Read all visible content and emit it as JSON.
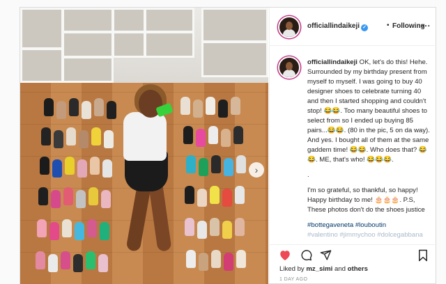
{
  "header": {
    "username": "officiallindaikeji",
    "verified_symbol": "✓",
    "dot": "•",
    "follow_status": "Following",
    "more_label": "..."
  },
  "caption": {
    "username": "officiallindaikeji",
    "paragraph1": "OK, let's do this! Hehe. Surrounded by my birthday present from myself to myself. I was going to buy 40 designer shoes to celebrate turning 40 and then I started shopping and couldn't stop! 😂😂. Too many beautiful shoes to select from so I ended up buying 85 pairs...😂😂. (80 in the pic, 5 on da way). And yes. I bought all of them at the same gaddem time! 😂😂. Who does that? 😂😂. ME, that's who! 😂😂😂.",
    "dot_line": ".",
    "paragraph2": "I'm so grateful, so thankful, so happy! Happy birthday to me! 🎂🎂🎂. P.S, These photos don't do the shoes justice",
    "hashtags": "#bottegaveneta #louboutin",
    "hashtags_more": "#valentino #jimmychoo #dolcegabbana"
  },
  "actions": {
    "like_icon": "heart-icon",
    "comment_icon": "comment-icon",
    "share_icon": "share-icon",
    "save_icon": "bookmark-icon"
  },
  "likes": {
    "prefix": "Liked by",
    "user": "mz_simi",
    "connector": "and",
    "others": "others"
  },
  "timestamp": "1 DAY AGO",
  "photo": {
    "next_arrow": "›"
  },
  "colors": {
    "like_red": "#ed4956",
    "verified_blue": "#3897f0",
    "hashtag_blue": "#00376b",
    "muted_gray": "#8e8e8e"
  }
}
